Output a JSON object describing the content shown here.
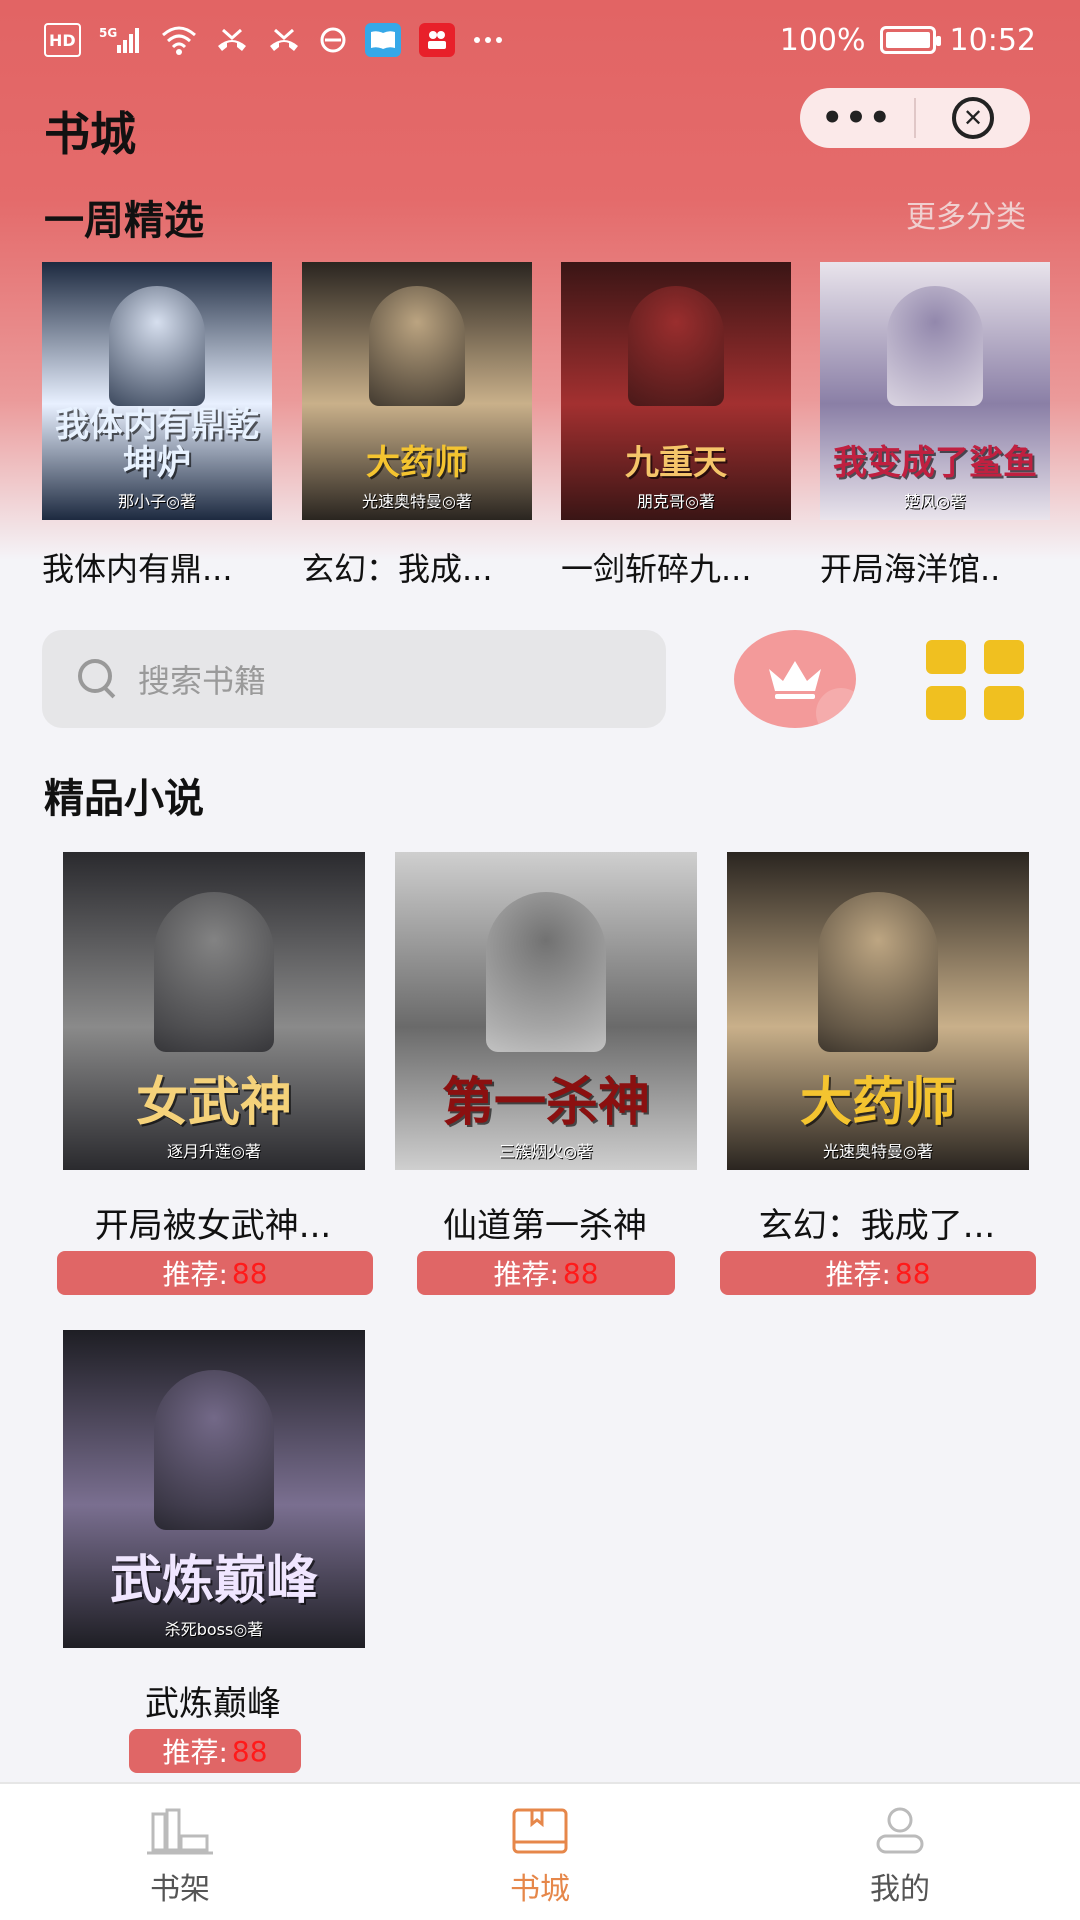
{
  "status_bar": {
    "left_icons": [
      "hd-badge-icon",
      "signal-5g-icon",
      "wifi-icon",
      "missed-call-icon",
      "missed-call-icon",
      "dnd-icon",
      "book-app-icon",
      "video-app-icon",
      "more-dots-icon"
    ],
    "hd_label": "HD",
    "signal_label": "5G",
    "battery_percent": "100%",
    "time": "10:52"
  },
  "header": {
    "title": "书城",
    "capsule_more_icon": "more-dots-icon",
    "capsule_close_icon": "close-circle-icon"
  },
  "weekly": {
    "title": "一周精选",
    "more_label": "更多分类",
    "books": [
      {
        "name": "我体内有鼎...",
        "cover_title": "我体内有鼎乾坤炉",
        "cover_author": "那小子◎著",
        "bg": "#1d2a40",
        "accent": "#e8f0ff",
        "title_color": "#e8f2ff"
      },
      {
        "name": "玄幻：我成...",
        "cover_title": "大药师",
        "cover_author": "光速奥特曼◎著",
        "bg": "#2a2520",
        "accent": "#c9b08a",
        "title_color": "#f4c430"
      },
      {
        "name": "一剑斩碎九...",
        "cover_title": "九重天",
        "cover_author": "朋克哥◎著",
        "bg": "#3a1515",
        "accent": "#a33030",
        "title_color": "#f5c56a"
      },
      {
        "name": "开局海洋馆..",
        "cover_title": "我变成了鲨鱼",
        "cover_author": "楚风◎著",
        "bg": "#e9e4ec",
        "accent": "#8a7fa6",
        "title_color": "#c02040"
      }
    ]
  },
  "search": {
    "placeholder": "搜索书籍",
    "crown_icon": "crown-icon",
    "grid_icon": "grid-icon"
  },
  "premium": {
    "title": "精品小说",
    "books": [
      {
        "name": "开局被女武神...",
        "cover_title": "女武神",
        "cover_author": "逐月升莲◎著",
        "bg": "#2a2a2e",
        "accent": "#8a8a8a",
        "title_color": "#f5d27a",
        "rec_label": "推荐:",
        "rec_value": "88"
      },
      {
        "name": "仙道第一杀神",
        "cover_title": "第一杀神",
        "cover_author": "三簇烟火◎著",
        "bg": "#cfcfcf",
        "accent": "#6a6a6a",
        "title_color": "#8b1010",
        "rec_label": "推荐:",
        "rec_value": "88"
      },
      {
        "name": "玄幻：我成了...",
        "cover_title": "大药师",
        "cover_author": "光速奥特曼◎著",
        "bg": "#2a2520",
        "accent": "#c9b08a",
        "title_color": "#f4c430",
        "rec_label": "推荐:",
        "rec_value": "88"
      },
      {
        "name": "武炼巅峰",
        "cover_title": "武炼巅峰",
        "cover_author": "杀死boss◎著",
        "bg": "#1e1e24",
        "accent": "#7a6f90",
        "title_color": "#f0e6ff",
        "rec_label": "推荐:",
        "rec_value": "88"
      }
    ]
  },
  "bottom_nav": {
    "items": [
      {
        "label": "书架",
        "icon": "bookshelf-icon",
        "active": false
      },
      {
        "label": "书城",
        "icon": "bookstore-icon",
        "active": true
      },
      {
        "label": "我的",
        "icon": "profile-icon",
        "active": false
      }
    ],
    "active_color": "#e6874a",
    "inactive_color": "#555555"
  }
}
